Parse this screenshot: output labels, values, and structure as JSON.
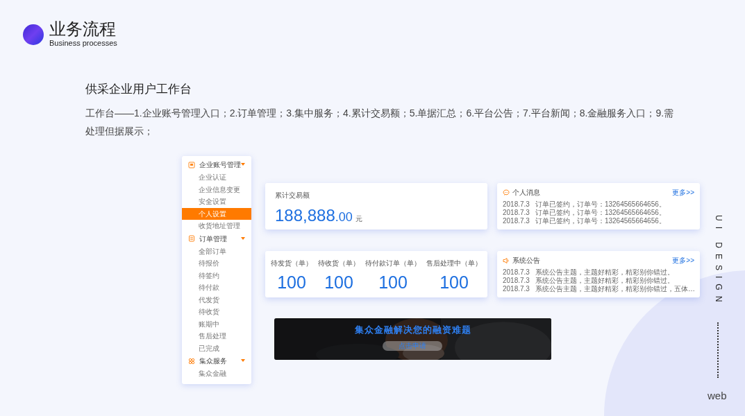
{
  "header": {
    "title": "业务流程",
    "subtitle": "Business processes"
  },
  "section": {
    "title": "供采企业用户工作台",
    "description": "工作台——1.企业账号管理入口；2.订单管理；3.集中服务；4.累计交易额；5.单据汇总；6.平台公告；7.平台新闻；8.金融服务入口；9.需处理但据展示；"
  },
  "sidebar": {
    "groups": [
      {
        "label": "企业账号管理",
        "kind": "account",
        "expanded": true,
        "items": [
          {
            "label": "企业认证",
            "selected": false
          },
          {
            "label": "企业信息变更",
            "selected": false
          },
          {
            "label": "安全设置",
            "selected": false
          },
          {
            "label": "个人设置",
            "selected": true
          },
          {
            "label": "收货地址管理",
            "selected": false
          }
        ]
      },
      {
        "label": "订单管理",
        "kind": "order",
        "expanded": true,
        "items": [
          {
            "label": "全部订单",
            "selected": false
          },
          {
            "label": "待报价",
            "selected": false
          },
          {
            "label": "待签约",
            "selected": false
          },
          {
            "label": "待付款",
            "selected": false
          },
          {
            "label": "代发货",
            "selected": false
          },
          {
            "label": "待收货",
            "selected": false
          },
          {
            "label": "账期中",
            "selected": false
          },
          {
            "label": "售后处理",
            "selected": false
          },
          {
            "label": "已完成",
            "selected": false
          }
        ]
      },
      {
        "label": "集众服务",
        "kind": "service",
        "expanded": true,
        "items": [
          {
            "label": "集众金融",
            "selected": false
          }
        ]
      }
    ]
  },
  "total": {
    "label": "累计交易额",
    "integer": "188,888",
    "decimals": ".00",
    "unit": "元"
  },
  "stats": [
    {
      "label": "待发货（单）",
      "value": "100"
    },
    {
      "label": "待收货（单）",
      "value": "100"
    },
    {
      "label": "待付款订单（单）",
      "value": "100"
    },
    {
      "label": "售后处理中（单）",
      "value": "100"
    }
  ],
  "messages": {
    "title": "个人消息",
    "more": "更多>>",
    "rows": [
      {
        "date": "2018.7.3",
        "text": "订单已签约，订单号：13264565664656。"
      },
      {
        "date": "2018.7.3",
        "text": "订单已签约，订单号：13264565664656。"
      },
      {
        "date": "2018.7.3",
        "text": "订单已签约，订单号：13264565664656。"
      }
    ]
  },
  "notices": {
    "title": "系统公告",
    "more": "更多>>",
    "rows": [
      {
        "date": "2018.7.3",
        "text": "系统公告主题，主题好精彩，精彩别你错过。"
      },
      {
        "date": "2018.7.3",
        "text": "系统公告主题，主题好精彩，精彩别你错过。"
      },
      {
        "date": "2018.7.3",
        "text": "系统公告主题，主题好精彩，精彩别你错过，五体…"
      }
    ]
  },
  "banner": {
    "kind": "picture",
    "headline": "集众金融解决您的融资难题",
    "button": "点击申请"
  },
  "side_label": {
    "title": "UI DESIGN",
    "tag": "web"
  }
}
